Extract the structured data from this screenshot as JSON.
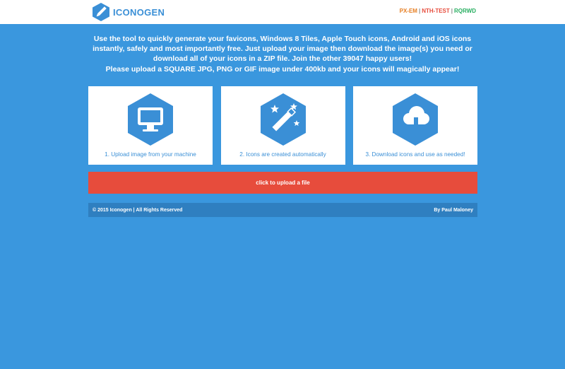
{
  "brand": {
    "name": "ICONOGEN",
    "color": "#3a8fd6"
  },
  "nav": {
    "links": [
      {
        "label": "PX-EM",
        "color": "#e67e22"
      },
      {
        "label": "NTH-TEST",
        "color": "#e74c3c"
      },
      {
        "label": "RQRWD",
        "color": "#27ae60"
      }
    ],
    "separator": "|"
  },
  "intro": {
    "lines": [
      "Use the tool to quickly generate your favicons, Windows 8 Tiles, Apple Touch icons, Android and iOS icons",
      "instantly, safely and most importantly free. Just upload your image then download the image(s) you need or",
      "download all of your icons in a ZIP file. Join the other 39047 happy users!",
      "Please upload a SQUARE JPG, PNG or GIF image under 400kb and your icons will magically appear!"
    ]
  },
  "steps": [
    {
      "icon": "monitor-icon",
      "caption": "1. Upload image from your machine"
    },
    {
      "icon": "magic-wand-icon",
      "caption": "2. Icons are created automatically"
    },
    {
      "icon": "cloud-download-icon",
      "caption": "3. Download icons and use as needed!"
    }
  ],
  "upload": {
    "label": "click to upload a file",
    "color": "#e74c3c"
  },
  "footer": {
    "copyright": "© 2015 Iconogen | All Rights Reserved",
    "author": "By Paul Maloney"
  },
  "colors": {
    "background": "#3a97de",
    "accent": "#2f7fc0"
  }
}
